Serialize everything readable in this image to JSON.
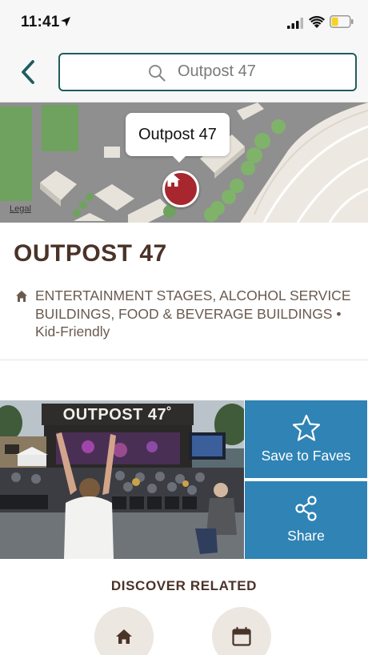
{
  "status_bar": {
    "time": "11:41"
  },
  "search": {
    "query": "Outpost 47"
  },
  "map": {
    "callout_label": "Outpost 47",
    "legal_label": "Legal"
  },
  "place": {
    "title": "OUTPOST 47",
    "categories": "ENTERTAINMENT STAGES, ALCOHOL SERVICE BUILDINGS, FOOD & BEVERAGE BUILDINGS • Kid-Friendly"
  },
  "photo": {
    "sign_text": "OUTPOST 47˚"
  },
  "actions": {
    "save_label": "Save to Faves",
    "share_label": "Share"
  },
  "discover": {
    "title": "DISCOVER RELATED"
  },
  "icons": {
    "back": "chevron-left-icon",
    "search": "search-icon",
    "pin": "home-icon",
    "faves": "star-icon",
    "share": "share-icon",
    "calendar": "calendar-icon"
  },
  "colors": {
    "accent_teal": "#1f5d5f",
    "action_blue": "#2f83b5",
    "pin_red": "#a8262e",
    "title_brown": "#4a3328",
    "round_button_bg": "#ece8e1"
  }
}
